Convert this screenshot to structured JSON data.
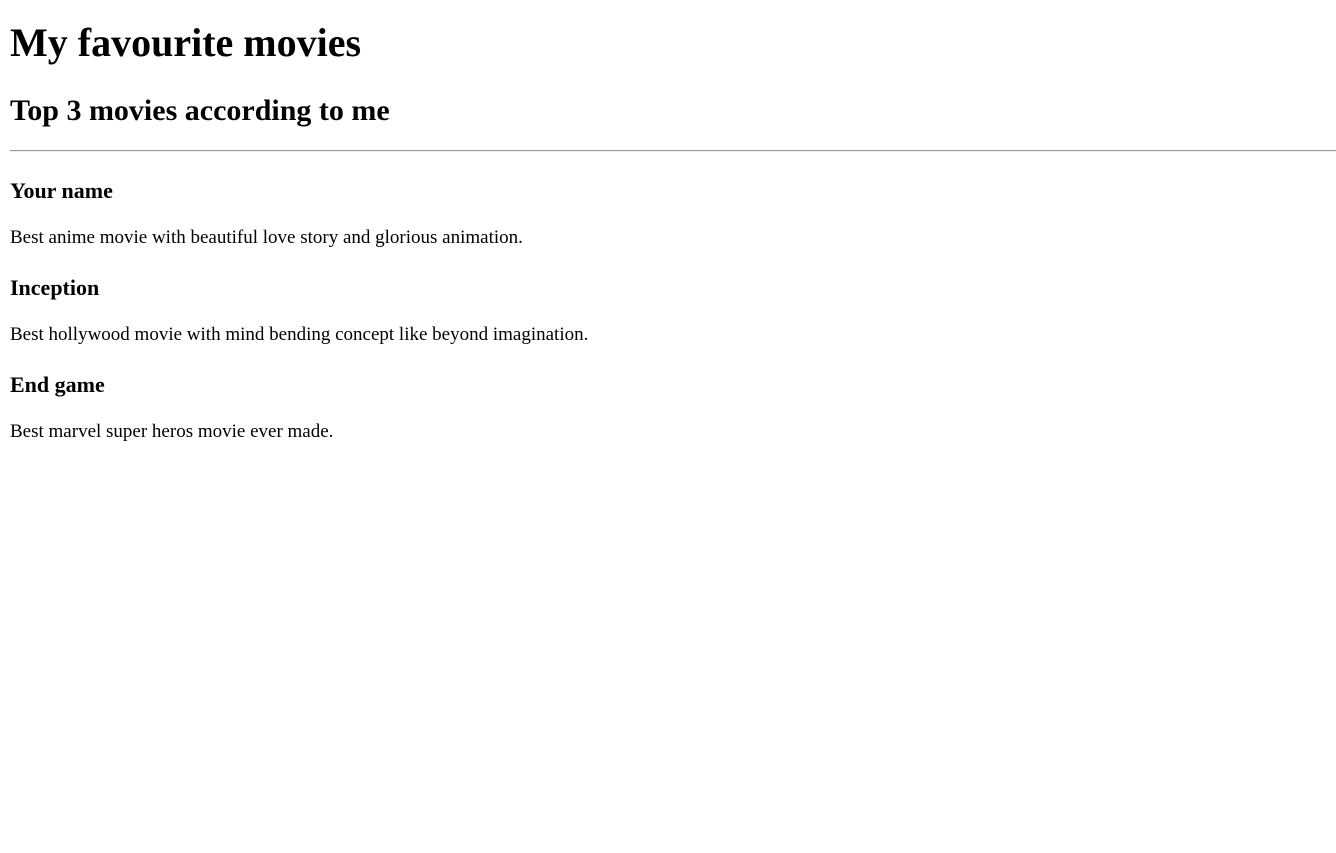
{
  "header": {
    "title": "My favourite movies",
    "subtitle": "Top 3 movies according to me"
  },
  "movies": [
    {
      "title": "Your name",
      "description": "Best anime movie with beautiful love story and glorious animation."
    },
    {
      "title": "Inception",
      "description": "Best hollywood movie with mind bending concept like beyond imagination."
    },
    {
      "title": "End game",
      "description": "Best marvel super heros movie ever made."
    }
  ]
}
